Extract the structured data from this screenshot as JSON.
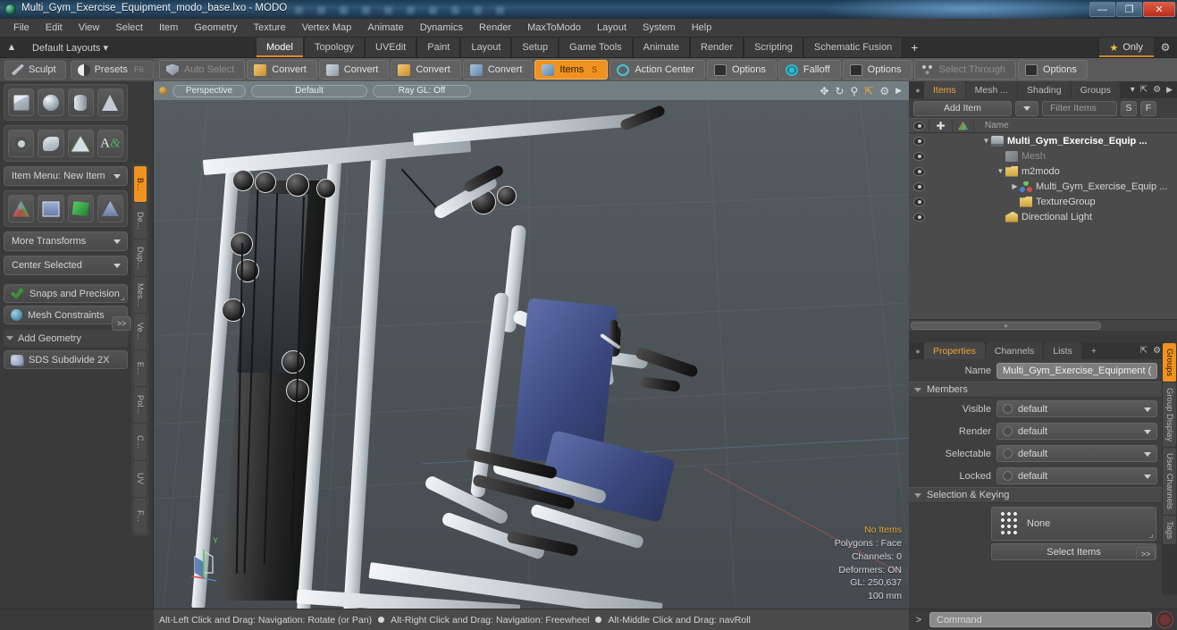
{
  "window": {
    "title": "Multi_Gym_Exercise_Equipment_modo_base.lxo - MODO",
    "app_icon": "modo-app-icon",
    "minimize": "—",
    "maximize": "❐",
    "close": "✕"
  },
  "menubar": {
    "items": [
      "File",
      "Edit",
      "View",
      "Select",
      "Item",
      "Geometry",
      "Texture",
      "Vertex Map",
      "Animate",
      "Dynamics",
      "Render",
      "MaxToModo",
      "Layout",
      "System",
      "Help"
    ]
  },
  "layoutbar": {
    "home_icon": "home-icon",
    "default_layouts": "Default Layouts ▾",
    "tabs": [
      {
        "label": "Model",
        "active": true
      },
      {
        "label": "Topology",
        "active": false
      },
      {
        "label": "UVEdit",
        "active": false
      },
      {
        "label": "Paint",
        "active": false
      },
      {
        "label": "Layout",
        "active": false
      },
      {
        "label": "Setup",
        "active": false
      },
      {
        "label": "Game Tools",
        "active": false
      },
      {
        "label": "Animate",
        "active": false
      },
      {
        "label": "Render",
        "active": false
      },
      {
        "label": "Scripting",
        "active": false
      },
      {
        "label": "Schematic Fusion",
        "active": false
      }
    ],
    "add_tab": "+",
    "only_label": "Only",
    "star_icon": "star-icon",
    "gear_icon": "gear-icon"
  },
  "modebar": {
    "sculpt": "Sculpt",
    "presets": "Presets",
    "presets_key": "F6",
    "chips": [
      {
        "label": "Auto Select",
        "icon": "shield-icon",
        "state": "dim"
      },
      {
        "label": "Convert",
        "icon": "cube-orange-icon",
        "state": "normal"
      },
      {
        "label": "Convert",
        "icon": "cube-grey-icon",
        "state": "normal"
      },
      {
        "label": "Convert",
        "icon": "cube-orange-icon",
        "state": "normal"
      },
      {
        "label": "Convert",
        "icon": "cube-blue-icon",
        "state": "normal"
      },
      {
        "label": "Items",
        "icon": "cube-blue-icon",
        "state": "active",
        "count": "S"
      },
      {
        "label": "Action Center",
        "icon": "target-icon",
        "state": "normal"
      },
      {
        "label": "Options",
        "icon": "checkbox-icon",
        "state": "normal"
      },
      {
        "label": "Falloff",
        "icon": "target-fill-icon",
        "state": "normal"
      },
      {
        "label": "Options",
        "icon": "checkbox-icon",
        "state": "normal"
      },
      {
        "label": "Select Through",
        "icon": "dots-icon",
        "state": "dim"
      },
      {
        "label": "Options",
        "icon": "checkbox-icon",
        "state": "normal"
      }
    ]
  },
  "left_panel": {
    "primitive_row1": [
      {
        "name": "cube-primitive",
        "shape": "cube"
      },
      {
        "name": "sphere-primitive",
        "shape": "sphere"
      },
      {
        "name": "cylinder-primitive",
        "shape": "cyl"
      },
      {
        "name": "cone-primitive",
        "shape": "cone"
      }
    ],
    "primitive_row2": [
      {
        "name": "torus-primitive",
        "shape": "torus"
      },
      {
        "name": "tube-primitive",
        "shape": "tube"
      },
      {
        "name": "triangle-primitive",
        "shape": "tri"
      },
      {
        "name": "text-primitive",
        "shape": "text"
      }
    ],
    "item_menu": "Item Menu: New Item",
    "transform_row": [
      {
        "name": "transform-tool",
        "shape": "tri2"
      },
      {
        "name": "grid-tool",
        "shape": "grid"
      },
      {
        "name": "green-tool",
        "shape": "green"
      },
      {
        "name": "blue-tool",
        "shape": "blue"
      }
    ],
    "more_transforms": "More Transforms",
    "center_selected": "Center Selected",
    "snaps_precision": "Snaps and Precision",
    "mesh_constraints": "Mesh Constraints",
    "add_geometry": "Add Geometry",
    "sds_subdivide": "SDS Subdivide 2X",
    "expand_label": ">>",
    "vtabs": [
      {
        "label": "B...",
        "active": true
      },
      {
        "label": "De...",
        "active": false
      },
      {
        "label": "Dup...",
        "active": false
      },
      {
        "label": "Mes...",
        "active": false
      },
      {
        "label": "Ve...",
        "active": false
      },
      {
        "label": "E...",
        "active": false
      },
      {
        "label": "Pol...",
        "active": false
      },
      {
        "label": "C...",
        "active": false
      },
      {
        "label": "UV",
        "active": false
      },
      {
        "label": "F...",
        "active": false
      }
    ]
  },
  "viewport": {
    "mode_dot": "viewport-indicator",
    "pills": [
      "Perspective",
      "Default",
      "Ray GL: Off"
    ],
    "nav_icons": [
      "pan-icon",
      "rotate-icon",
      "zoom-icon",
      "fit-icon",
      "gear-icon",
      "chevron-right-icon"
    ],
    "stats": {
      "no_items": "No Items",
      "polygons": "Polygons : Face",
      "channels": "Channels: 0",
      "deformers": "Deformers: ON",
      "gl": "GL: 250,637",
      "scale": "100 mm"
    },
    "gizmo_axis": "Y"
  },
  "items_panel": {
    "tabs": [
      {
        "label": "Items",
        "active": true
      },
      {
        "label": "Mesh ...",
        "active": false
      },
      {
        "label": "Shading",
        "active": false
      },
      {
        "label": "Groups",
        "active": false
      }
    ],
    "tab_overflow": "▾",
    "expand_icon": "expand-icon",
    "gear_icon": "gear-icon",
    "more_icon": "chevron-right-icon",
    "add_item": "Add Item",
    "filter_placeholder": "Filter Items",
    "btn_s": "S",
    "btn_f": "F",
    "columns": {
      "eye": "visibility-icon",
      "plus": "add-icon",
      "shade": "shading-icon",
      "name": "Name"
    },
    "rows": [
      {
        "label": "Multi_Gym_Exercise_Equip ...",
        "indent": 0,
        "icon": "scene",
        "style": "root",
        "twist": "▼"
      },
      {
        "label": "Mesh",
        "indent": 1,
        "icon": "mesh",
        "style": "dim",
        "twist": ""
      },
      {
        "label": "m2modo",
        "indent": 1,
        "icon": "grp",
        "style": "normal",
        "twist": "▼"
      },
      {
        "label": "Multi_Gym_Exercise_Equip ...",
        "indent": 2,
        "icon": "asm",
        "style": "normal",
        "twist": "▶"
      },
      {
        "label": "TextureGroup",
        "indent": 2,
        "icon": "grp",
        "style": "normal",
        "twist": ""
      },
      {
        "label": "Directional Light",
        "indent": 1,
        "icon": "light",
        "style": "normal",
        "twist": ""
      }
    ]
  },
  "properties_panel": {
    "tabs": [
      {
        "label": "Properties",
        "active": true
      },
      {
        "label": "Channels",
        "active": false
      },
      {
        "label": "Lists",
        "active": false
      }
    ],
    "add_tab": "+",
    "expand_icon": "expand-icon",
    "gear_icon": "gear-icon",
    "more_icon": "chevron-right-icon",
    "name_label": "Name",
    "name_value": "Multi_Gym_Exercise_Equipment (",
    "members_section": "Members",
    "members": [
      {
        "label": "Visible",
        "value": "default"
      },
      {
        "label": "Render",
        "value": "default"
      },
      {
        "label": "Selectable",
        "value": "default"
      },
      {
        "label": "Locked",
        "value": "default"
      }
    ],
    "selection_section": "Selection & Keying",
    "selection_value": "None",
    "select_items_btn": "Select Items",
    "expand_label": ">>",
    "vtabs": [
      {
        "label": "Groups",
        "active": true
      },
      {
        "label": "Group Display",
        "active": false
      },
      {
        "label": "User Channels",
        "active": false
      },
      {
        "label": "Tags",
        "active": false
      }
    ]
  },
  "statusbar": {
    "hints": [
      "Alt-Left Click and Drag: Navigation: Rotate (or Pan)",
      "Alt-Right Click and Drag: Navigation: Freewheel",
      "Alt-Middle Click and Drag: navRoll"
    ]
  },
  "commandbar": {
    "prompt": ">",
    "placeholder": "Command",
    "record_icon": "record-icon"
  },
  "colors": {
    "accent_orange": "#f0921f",
    "panel_bg": "#3a3a3a",
    "viewport_bg": "#4f5558",
    "model_white": "#d7dde1",
    "model_blue": "#3e4a80",
    "model_black": "#1a1a1a",
    "title_blue": "#2d5575"
  }
}
